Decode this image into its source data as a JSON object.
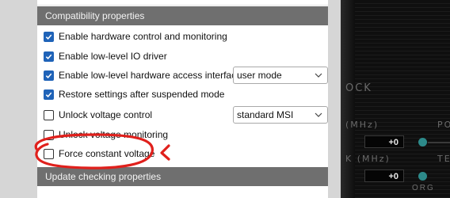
{
  "background_app": {
    "label_mhz_1": "(MHz)",
    "label_mhz_2": "K (MHz)",
    "label_ock": "OCK",
    "label_po": "PO",
    "label_te": "TE",
    "value_1": "+0",
    "value_2": "+0",
    "logo_text": "ORG"
  },
  "compatibility": {
    "header": "Compatibility properties",
    "options": [
      {
        "label": "Enable hardware control and monitoring",
        "checked": true
      },
      {
        "label": "Enable low-level IO driver",
        "checked": true
      },
      {
        "label": "Enable low-level hardware access interface",
        "checked": true
      },
      {
        "label": "Restore settings after suspended mode",
        "checked": true
      },
      {
        "label": "Unlock voltage control",
        "checked": false
      },
      {
        "label": "Unlock voltage monitoring",
        "checked": false
      },
      {
        "label": "Force constant voltage",
        "checked": false
      }
    ],
    "access_mode_select": {
      "value": "user mode"
    },
    "voltage_control_select": {
      "value": "standard MSI"
    }
  },
  "update_checking": {
    "header": "Update checking properties"
  },
  "colors": {
    "header_bg": "#6f6f6f",
    "checkbox_checked": "#1f63b8",
    "annotation_red": "#e0201c",
    "accent_teal": "#2d8a8a"
  }
}
